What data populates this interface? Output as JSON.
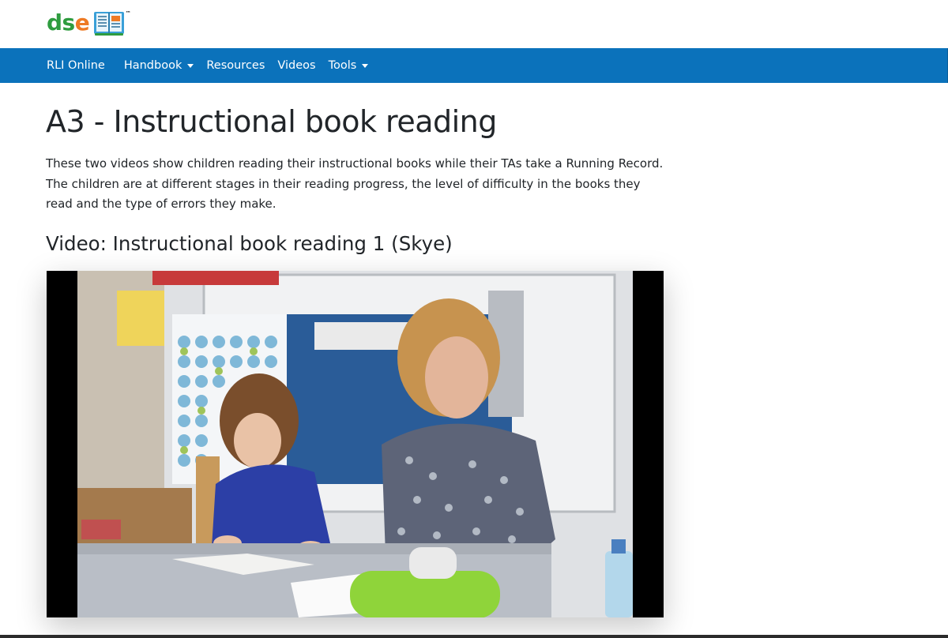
{
  "header": {
    "logo": {
      "part1": "ds",
      "part2": "e",
      "trademark": "™",
      "icon": "open-book-icon"
    }
  },
  "nav": {
    "brand": "RLI Online",
    "items": [
      {
        "label": "Handbook",
        "dropdown": true
      },
      {
        "label": "Resources",
        "dropdown": false
      },
      {
        "label": "Videos",
        "dropdown": false
      },
      {
        "label": "Tools",
        "dropdown": true
      }
    ],
    "background": "#0b72bb"
  },
  "main": {
    "title": "A3 - Instructional book reading",
    "intro": "These two videos show children reading their instructional books while their TAs take a Running Record. The children are at different stages in their reading progress, the level of difficulty in the books they read and the type of errors they make.",
    "video_heading": "Video: Instructional book reading 1 (Skye)"
  },
  "colors": {
    "logo_green": "#2e9c3f",
    "logo_orange": "#ee7a24"
  }
}
